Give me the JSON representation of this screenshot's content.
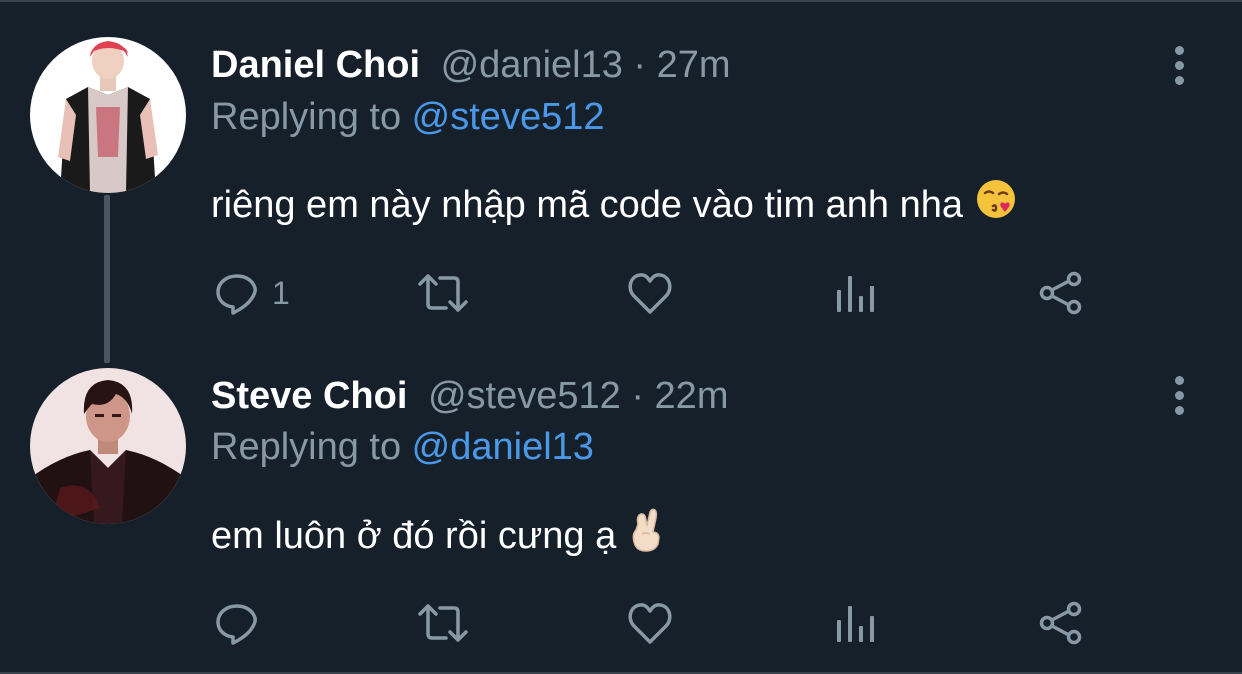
{
  "tweets": [
    {
      "name": "Daniel Choi",
      "handle": "@daniel13",
      "separator": "·",
      "time": "27m",
      "replying_prefix": "Replying to ",
      "replying_to": "@steve512",
      "text": "riêng em này nhập mã code vào tim anh nha",
      "emoji": "face-blowing-kiss-emoji",
      "reply_count": "1",
      "avatar": "avatar-daniel"
    },
    {
      "name": "Steve Choi",
      "handle": "@steve512",
      "separator": "·",
      "time": "22m",
      "replying_prefix": "Replying to ",
      "replying_to": "@daniel13",
      "text": "em luôn ở đó rồi cưng ạ",
      "emoji": "hand-with-index-finger-and-thumb-crossed-emoji",
      "reply_count": "",
      "avatar": "avatar-steve"
    }
  ],
  "icons": {
    "reply": "reply-icon",
    "retweet": "retweet-icon",
    "like": "heart-icon",
    "analytics": "analytics-icon",
    "share": "share-icon",
    "more": "more-vertical-icon"
  },
  "colors": {
    "background": "#15202b",
    "primary_text": "#ffffff",
    "secondary_text": "#8899a6",
    "mention": "#4a99e9",
    "thread_line": "#4a5561"
  }
}
